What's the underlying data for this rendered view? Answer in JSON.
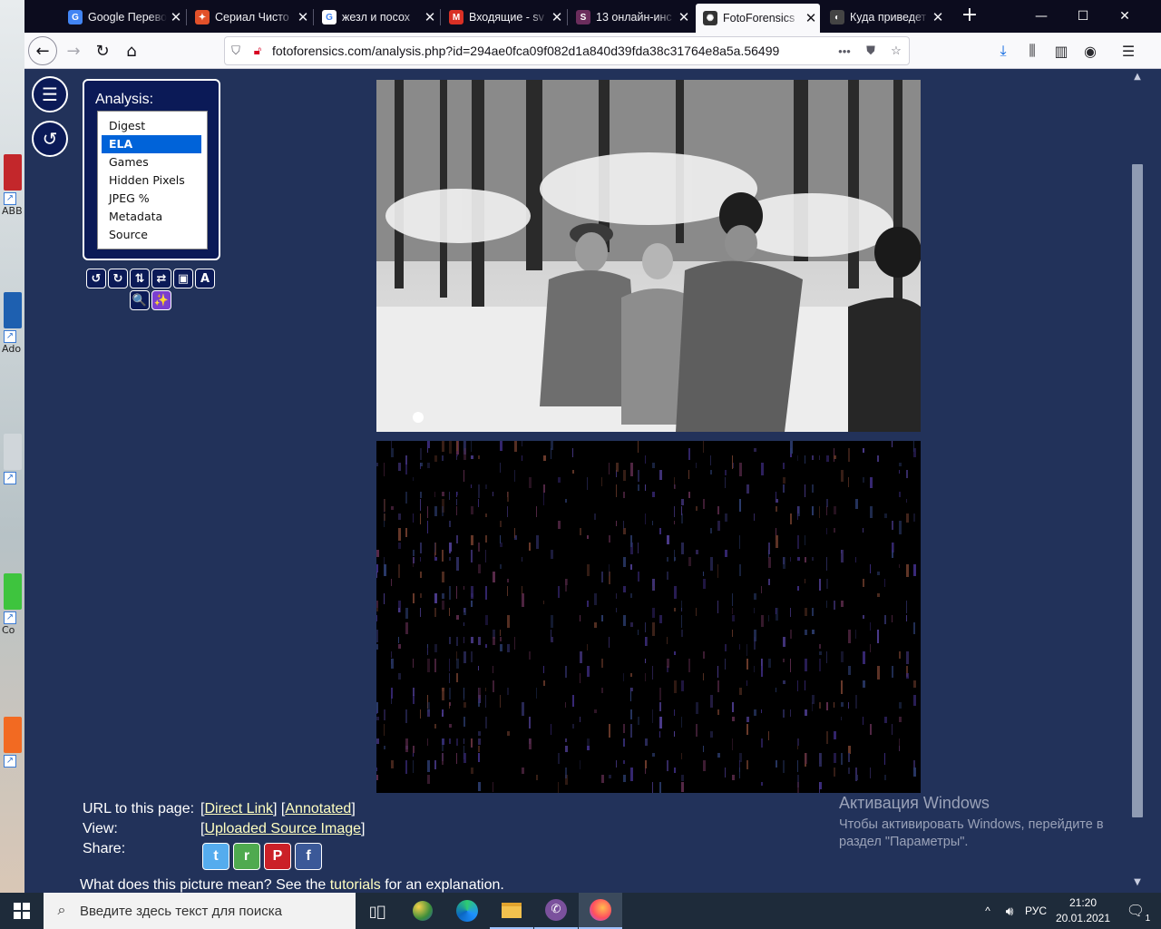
{
  "desktop": {
    "icons": [
      {
        "label": "ABB",
        "color": "#c3272b"
      },
      {
        "label": "Ado",
        "color": "#1e60b0"
      },
      {
        "label": "",
        "color": "#d0d6da"
      },
      {
        "label": "Co",
        "color": "#3ec43e"
      },
      {
        "label": "",
        "color": "#f26a22"
      }
    ]
  },
  "browser": {
    "tabs": [
      {
        "title": "Google Перевод",
        "favicon": "google-translate-icon",
        "color": "#4285f4",
        "glyph": "G"
      },
      {
        "title": "Сериал Чисто",
        "favicon": "fire-icon",
        "color": "#e2512a",
        "glyph": "✦"
      },
      {
        "title": "жезл и посох",
        "favicon": "google-icon",
        "color": "#ffffff",
        "glyph": "G"
      },
      {
        "title": "Входящие - sv",
        "favicon": "gmail-icon",
        "color": "#d93025",
        "glyph": "M"
      },
      {
        "title": "13 онлайн-инс",
        "favicon": "site-icon",
        "color": "#6b2d5c",
        "glyph": "S"
      },
      {
        "title": "FotoForensics",
        "favicon": "fotoforensics-icon",
        "color": "#333333",
        "glyph": "✺",
        "active": true
      },
      {
        "title": "Куда приведет",
        "favicon": "site-icon",
        "color": "#444444",
        "glyph": "◐"
      }
    ],
    "url": "fotoforensics.com/analysis.php?id=294ae0fca09f082d1a840d39fda38c31764e8a5a.56499",
    "window_controls": {
      "minimize": "—",
      "maximize": "☐",
      "close": "✕"
    }
  },
  "sidebar": {
    "menu_glyph": "☰",
    "reset_glyph": "↺"
  },
  "analysis": {
    "title": "Analysis:",
    "items": [
      "Digest",
      "ELA",
      "Games",
      "Hidden Pixels",
      "JPEG %",
      "Metadata",
      "Source"
    ],
    "selected": "ELA"
  },
  "tools": [
    {
      "glyph": "↺",
      "name": "rotate-left-tool"
    },
    {
      "glyph": "↻",
      "name": "rotate-right-tool"
    },
    {
      "glyph": "⇅",
      "name": "flip-vertical-tool"
    },
    {
      "glyph": "⇄",
      "name": "flip-horizontal-tool"
    },
    {
      "glyph": "▣",
      "name": "fit-tool"
    },
    {
      "glyph": "A",
      "name": "annotate-tool"
    },
    {
      "glyph": "🔍",
      "name": "zoom-tool"
    },
    {
      "glyph": "✨",
      "name": "enhance-tool"
    }
  ],
  "info": {
    "url_label": "URL to this page:",
    "direct_link": "Direct Link",
    "annotated": "Annotated",
    "view_label": "View:",
    "uploaded_source": "Uploaded Source Image",
    "share_label": "Share:",
    "share": [
      {
        "name": "twitter-share-icon",
        "color": "#55acee",
        "glyph": "t"
      },
      {
        "name": "reddit-share-icon",
        "color": "#4faa4f",
        "glyph": "r"
      },
      {
        "name": "pinterest-share-icon",
        "color": "#cb2027",
        "glyph": "P"
      },
      {
        "name": "facebook-share-icon",
        "color": "#3b5998",
        "glyph": "f"
      }
    ],
    "explain_pre": "What does this picture mean? See the ",
    "explain_link": "tutorials",
    "explain_post": " for an explanation."
  },
  "activation": {
    "title": "Активация Windows",
    "desc": "Чтобы активировать Windows, перейдите в раздел \"Параметры\"."
  },
  "taskbar": {
    "search_placeholder": "Введите здесь текст для поиска",
    "language": "РУС",
    "time": "21:20",
    "date": "20.01.2021",
    "notifications": "1"
  }
}
